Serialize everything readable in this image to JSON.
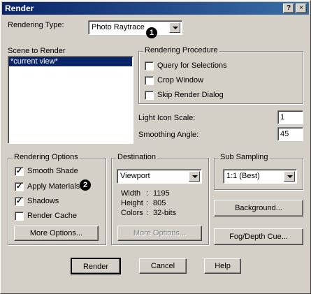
{
  "window": {
    "title": "Render",
    "help_btn": "?",
    "close_btn": "×"
  },
  "rendering_type": {
    "label": "Rendering Type:",
    "value": "Photo Raytrace"
  },
  "badges": [
    "1",
    "2"
  ],
  "scene": {
    "label": "Scene to Render",
    "items": [
      "*current view*"
    ]
  },
  "procedure": {
    "label": "Rendering Procedure",
    "items": [
      {
        "label": "Query for Selections",
        "checked": false
      },
      {
        "label": "Crop Window",
        "checked": false
      },
      {
        "label": "Skip Render Dialog",
        "checked": false
      }
    ]
  },
  "light_icon_scale": {
    "label": "Light Icon Scale:",
    "value": "1"
  },
  "smoothing_angle": {
    "label": "Smoothing Angle:",
    "value": "45"
  },
  "options": {
    "label": "Rendering Options",
    "items": [
      {
        "label": "Smooth Shade",
        "checked": true
      },
      {
        "label": "Apply Materials",
        "checked": true
      },
      {
        "label": "Shadows",
        "checked": true
      },
      {
        "label": "Render Cache",
        "checked": false
      }
    ],
    "more_btn": "More Options..."
  },
  "destination": {
    "label": "Destination",
    "value": "Viewport",
    "width_label": "Width",
    "width_val": "1195",
    "height_label": "Height",
    "height_val": "805",
    "colors_label": "Colors",
    "colors_val": "32-bits",
    "more_btn": "More Options..."
  },
  "subsampling": {
    "label": "Sub Sampling",
    "value": "1:1 (Best)"
  },
  "background_btn": "Background...",
  "fog_btn": "Fog/Depth Cue...",
  "footer": {
    "render": "Render",
    "cancel": "Cancel",
    "help": "Help"
  }
}
